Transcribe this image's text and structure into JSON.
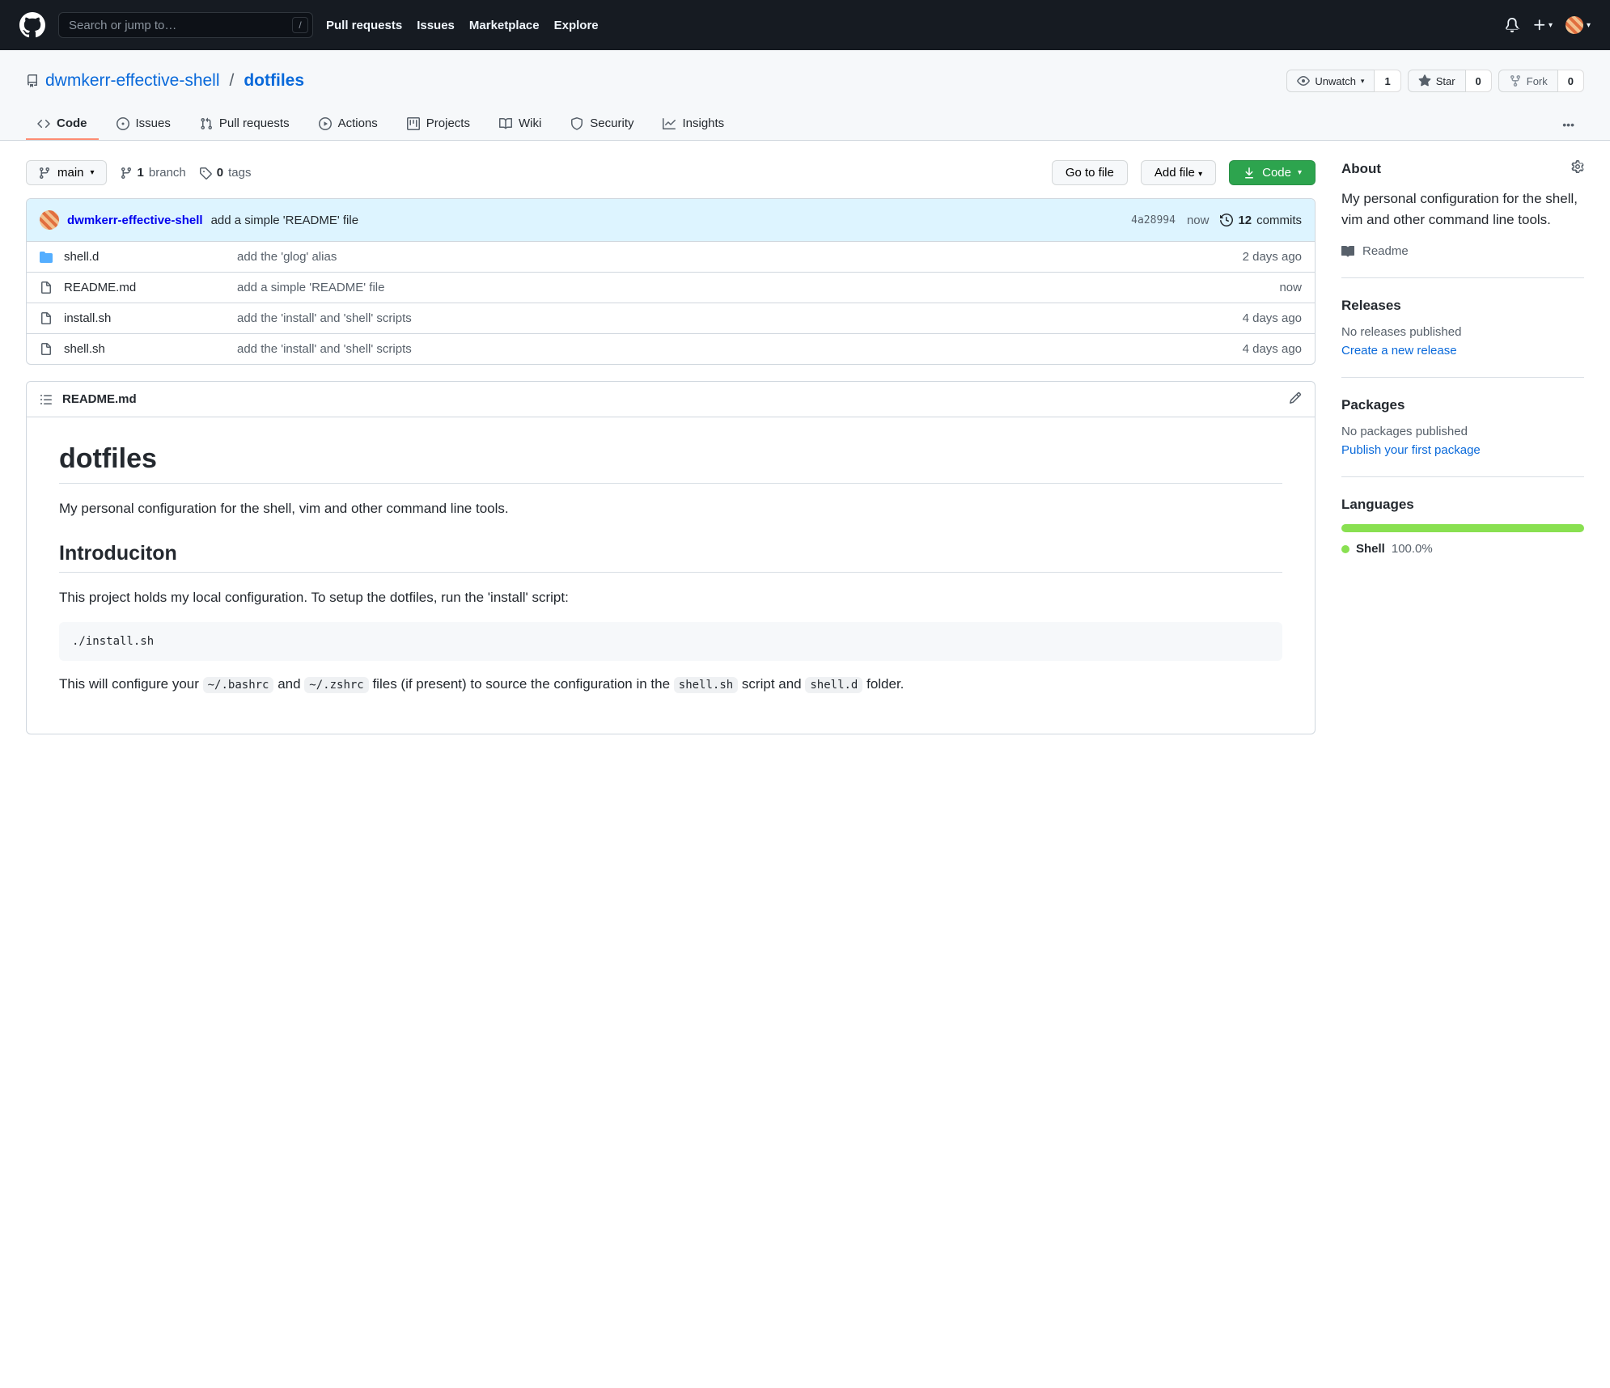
{
  "header": {
    "search_placeholder": "Search or jump to…",
    "slash": "/",
    "links": [
      "Pull requests",
      "Issues",
      "Marketplace",
      "Explore"
    ]
  },
  "repo": {
    "owner": "dwmkerr-effective-shell",
    "name": "dotfiles",
    "actions": {
      "watch_label": "Unwatch",
      "watch_count": "1",
      "star_label": "Star",
      "star_count": "0",
      "fork_label": "Fork",
      "fork_count": "0"
    }
  },
  "tabs": {
    "code": "Code",
    "issues": "Issues",
    "pulls": "Pull requests",
    "actions": "Actions",
    "projects": "Projects",
    "wiki": "Wiki",
    "security": "Security",
    "insights": "Insights"
  },
  "filenav": {
    "branch": "main",
    "branch_count": "1",
    "branch_label": "branch",
    "tag_count": "0",
    "tag_label": "tags",
    "go_to_file": "Go to file",
    "add_file": "Add file",
    "code": "Code"
  },
  "commit": {
    "author": "dwmkerr-effective-shell",
    "message": "add a simple 'README' file",
    "sha": "4a28994",
    "time": "now",
    "count": "12",
    "count_label": "commits"
  },
  "files": [
    {
      "type": "dir",
      "name": "shell.d",
      "msg": "add the 'glog' alias",
      "time": "2 days ago"
    },
    {
      "type": "file",
      "name": "README.md",
      "msg": "add a simple 'README' file",
      "time": "now"
    },
    {
      "type": "file",
      "name": "install.sh",
      "msg": "add the 'install' and 'shell' scripts",
      "time": "4 days ago"
    },
    {
      "type": "file",
      "name": "shell.sh",
      "msg": "add the 'install' and 'shell' scripts",
      "time": "4 days ago"
    }
  ],
  "readme": {
    "filename": "README.md",
    "h1": "dotfiles",
    "p1": "My personal configuration for the shell, vim and other command line tools.",
    "h2": "Introduciton",
    "p2": "This project holds my local configuration. To setup the dotfiles, run the 'install' script:",
    "code": "./install.sh",
    "p3a": "This will configure your ",
    "c1": "~/.bashrc",
    "p3b": " and ",
    "c2": "~/.zshrc",
    "p3c": " files (if present) to source the configuration in the ",
    "c3": "shell.sh",
    "p3d": " script and ",
    "c4": "shell.d",
    "p3e": " folder."
  },
  "sidebar": {
    "about_title": "About",
    "about_desc": "My personal configuration for the shell, vim and other command line tools.",
    "readme_link": "Readme",
    "releases_title": "Releases",
    "releases_empty": "No releases published",
    "releases_link": "Create a new release",
    "packages_title": "Packages",
    "packages_empty": "No packages published",
    "packages_link": "Publish your first package",
    "languages_title": "Languages",
    "lang_name": "Shell",
    "lang_pct": "100.0%"
  }
}
